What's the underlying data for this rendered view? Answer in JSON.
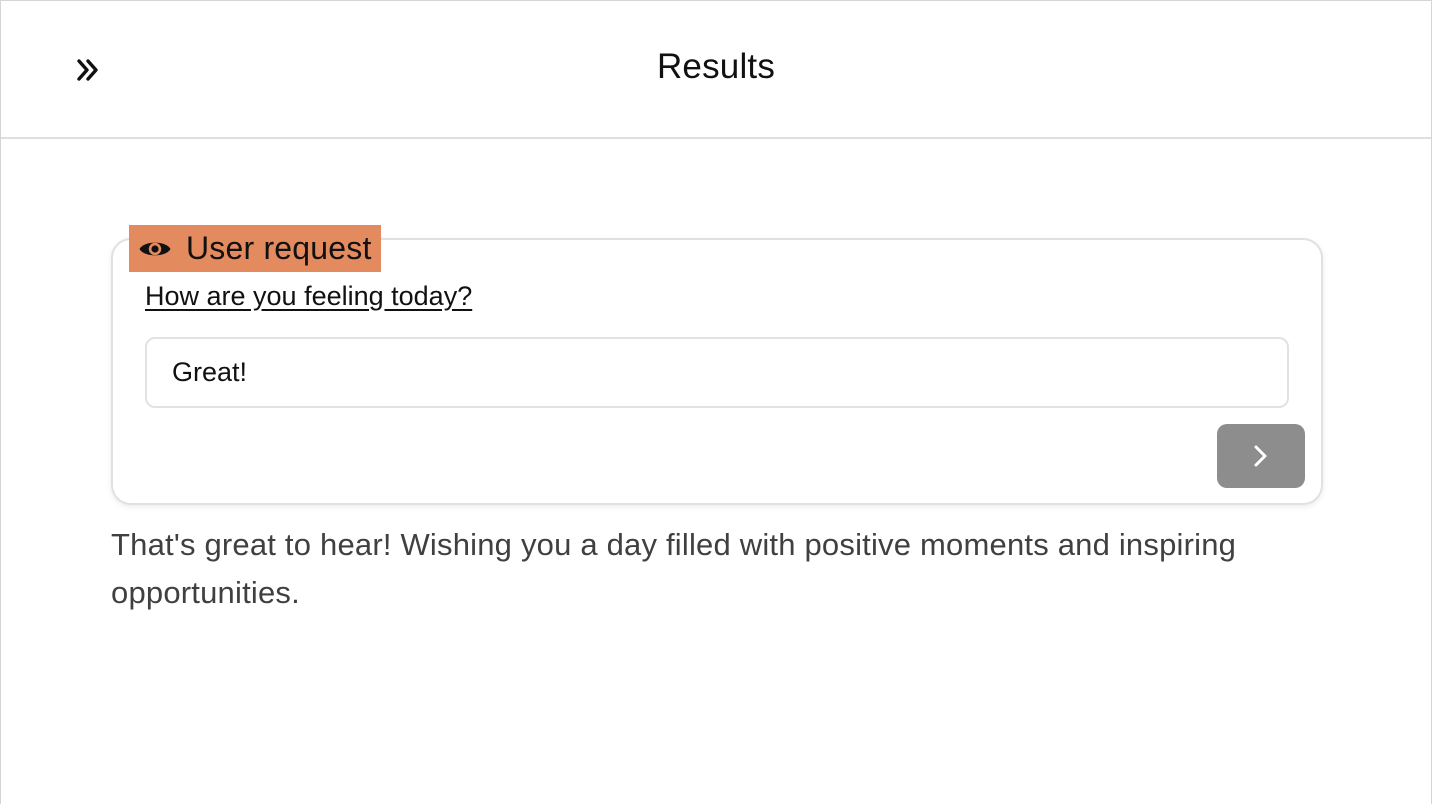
{
  "header": {
    "title": "Results",
    "expand_icon": "double-chevron-right-icon"
  },
  "user_request": {
    "badge_label": "User request",
    "badge_icon": "eye-icon",
    "badge_color": "#e48a5f",
    "question": "How are you feeling today?",
    "answer_value": "Great!",
    "submit_icon": "chevron-right-icon",
    "submit_color": "#8d8d8d"
  },
  "response": {
    "text": "That's great to hear! Wishing you a day filled with positive moments and inspiring opportunities."
  }
}
